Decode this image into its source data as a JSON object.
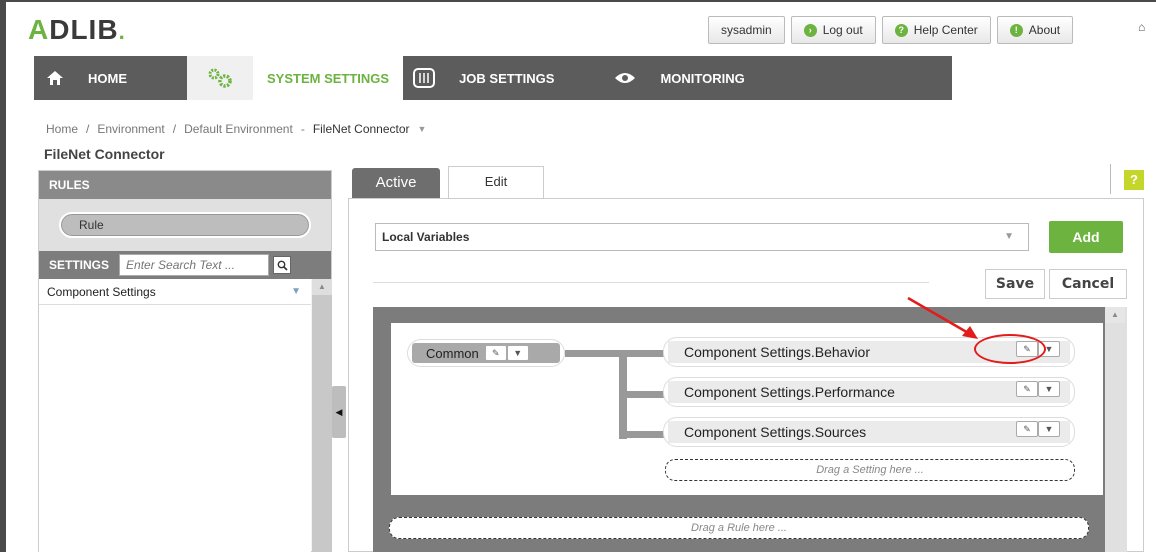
{
  "header": {
    "logo": "ADLIB.",
    "top_links": {
      "user": "sysadmin",
      "logout": "Log out",
      "help": "Help Center",
      "about": "About"
    }
  },
  "nav": {
    "items": [
      {
        "label": "HOME",
        "icon": "home-icon"
      },
      {
        "label": "SYSTEM SETTINGS",
        "icon": "gears-icon",
        "active": true
      },
      {
        "label": "JOB SETTINGS",
        "icon": "sliders-icon"
      },
      {
        "label": "MONITORING",
        "icon": "eye-icon"
      }
    ]
  },
  "breadcrumb": {
    "home": "Home",
    "environment": "Environment",
    "default_env": "Default Environment",
    "current": "FileNet Connector",
    "sep": "/",
    "dash": "-"
  },
  "page": {
    "title": "FileNet Connector"
  },
  "left": {
    "rules_header": "RULES",
    "rule_button": "Rule",
    "settings_label": "SETTINGS",
    "search_placeholder": "Enter Search Text ...",
    "settings_items": [
      "Component Settings"
    ]
  },
  "tabs": {
    "active": "Active",
    "edit": "Edit"
  },
  "help_badge": "?",
  "edit": {
    "variables_select": "Local Variables",
    "add": "Add",
    "save": "Save",
    "cancel": "Cancel",
    "common_node": "Common",
    "settings": [
      "Component Settings.Behavior",
      "Component Settings.Performance",
      "Component Settings.Sources"
    ],
    "drag_setting": "Drag a Setting here ...",
    "drag_rule": "Drag a Rule here ..."
  },
  "colors": {
    "brand_green": "#6cb33f",
    "nav_dark": "#5c5c5c",
    "annotation_red": "#e31b1b",
    "help_yellow": "#c4d62a"
  }
}
